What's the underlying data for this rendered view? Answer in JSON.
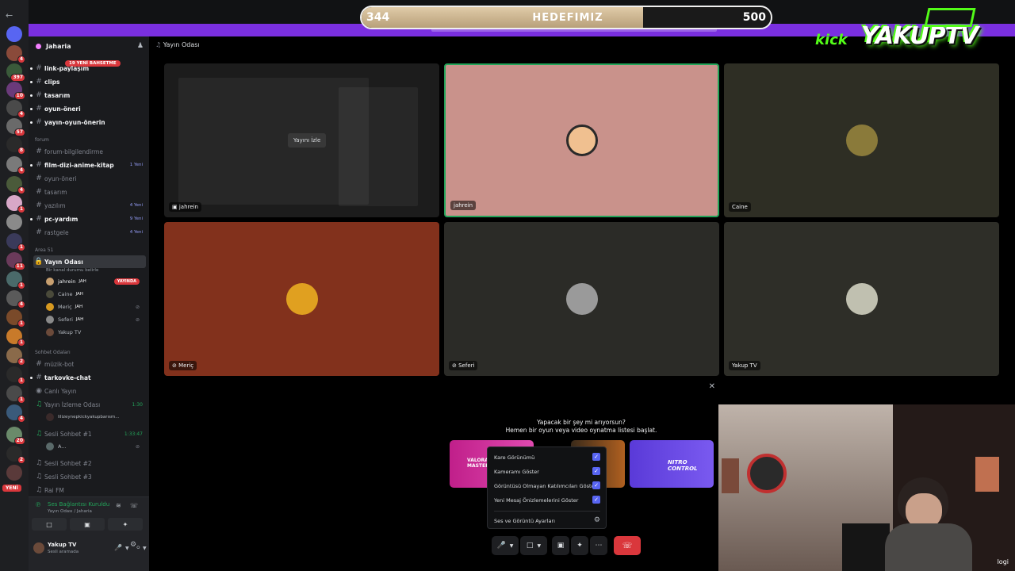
{
  "goal": {
    "current": "344",
    "label": "HEDEFIMIZ",
    "target": "500",
    "progress": 0.688
  },
  "logo": {
    "kick": "kick",
    "channel": "YAKUPTV"
  },
  "server": {
    "name": "Jaharia",
    "new_messages_badge": "19 YENİ BAHSETME"
  },
  "channels_top": [
    {
      "label": "link-paylaşım",
      "bold": true
    },
    {
      "label": "clips",
      "bold": true
    },
    {
      "label": "tasarım",
      "bold": true
    },
    {
      "label": "oyun-öneri",
      "bold": true
    },
    {
      "label": "yayın-oyun-önerin",
      "bold": true
    }
  ],
  "category_forum": "forum",
  "channels_forum": [
    {
      "label": "forum-bilgilendirme",
      "bold": false,
      "count": ""
    },
    {
      "label": "film-dizi-anime-kitap",
      "bold": true,
      "count": "1 Yeni"
    },
    {
      "label": "oyun-öneri",
      "bold": false,
      "count": ""
    },
    {
      "label": "tasarım",
      "bold": false,
      "count": ""
    },
    {
      "label": "yazılım",
      "bold": false,
      "count": "4 Yeni"
    },
    {
      "label": "pc-yardım",
      "bold": true,
      "count": "9 Yeni"
    },
    {
      "label": "rastgele",
      "bold": false,
      "count": "4 Yeni"
    }
  ],
  "category_area": "Area 51",
  "stage": {
    "label": "Yayın Odası",
    "status": "Bir kanal durumu belirle"
  },
  "stage_users": [
    {
      "name": "jahrein",
      "tag": "JAH",
      "live": "YAYINDA"
    },
    {
      "name": "Caine",
      "tag": "JAH"
    },
    {
      "name": "Meriç",
      "tag": "JAH"
    },
    {
      "name": "Seferi",
      "tag": "JAH"
    },
    {
      "name": "Yakup TV",
      "tag": ""
    }
  ],
  "category_sohbet": "Sohbet Odaları",
  "channels_sohbet": [
    {
      "label": "müzik-bot",
      "bold": false
    },
    {
      "label": "tarkovke-chat",
      "bold": true
    },
    {
      "label": "Canlı Yayın",
      "bold": false
    },
    {
      "label": "Yayın İzleme Odası",
      "bold": false,
      "time": "1:30"
    },
    {
      "label": "Sesli Sohbet #1",
      "bold": false,
      "time": "1:33:47"
    },
    {
      "label": "Sesli Sohbet #2",
      "bold": false
    },
    {
      "label": "Sesli Sohbet #3",
      "bold": false
    },
    {
      "label": "Rai FM",
      "bold": false
    }
  ],
  "watch_room_user": "lilizeynepkickyakupbarısm...",
  "sesli1_user": "A...",
  "rail_yeni": "YENİ",
  "voice_panel": {
    "status": "Ses Bağlantısı Kuruldu",
    "channel": "Yayın Odası / Jaharia"
  },
  "user_panel": {
    "name": "Yakup TV",
    "status": "Sesli aramada"
  },
  "main_header": "Yayın Odası",
  "tiles": [
    {
      "name": "jahrein",
      "color": "#1c1c1c",
      "watch": "Yayını İzle"
    },
    {
      "name": "jahrein",
      "color": "#c9928b"
    },
    {
      "name": "Caine",
      "color": "#2e2e24"
    },
    {
      "name": "Meriç",
      "color": "#82311c"
    },
    {
      "name": "Seferi",
      "color": "#2b2b27"
    },
    {
      "name": "Yakup TV",
      "color": "#2e2e28"
    }
  ],
  "activity": {
    "question": "Yapacak bir şey mi arıyorsun?",
    "prompt": "Hemen bir oyun veya video oynatma listesi başlat."
  },
  "cards": [
    {
      "label": "VALORANT MASTERS"
    },
    {
      "label": "NITRO CONTROL"
    }
  ],
  "menu": [
    {
      "label": "Kare Görünümü",
      "checked": true
    },
    {
      "label": "Kameramı Göster",
      "checked": true
    },
    {
      "label": "Görüntüsü Olmayan Katılımcıları Göster",
      "checked": true
    },
    {
      "label": "Yeni Mesaj Önizlemelerini Göster",
      "checked": true
    }
  ],
  "menu_settings": "Ses ve Görüntü Ayarları",
  "webcam_brand": "logi",
  "colors": {
    "accent": "#5865f2",
    "danger": "#da373c",
    "online": "#23a55a",
    "kick": "#53fc18",
    "banner": "#7a2fe0"
  }
}
